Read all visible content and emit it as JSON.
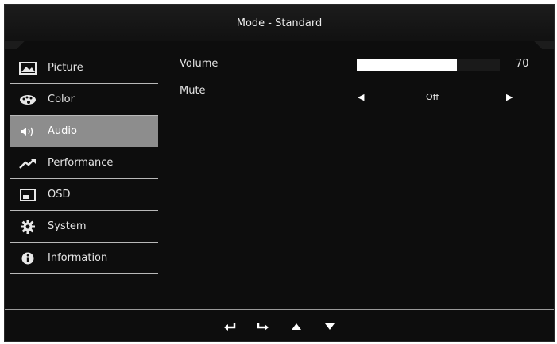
{
  "header": {
    "title": "Mode - Standard"
  },
  "sidebar": {
    "items": [
      {
        "label": "Picture",
        "icon": "picture-icon"
      },
      {
        "label": "Color",
        "icon": "palette-icon"
      },
      {
        "label": "Audio",
        "icon": "speaker-icon",
        "active": true
      },
      {
        "label": "Performance",
        "icon": "trend-up-icon"
      },
      {
        "label": "OSD",
        "icon": "osd-window-icon"
      },
      {
        "label": "System",
        "icon": "gear-icon"
      },
      {
        "label": "Information",
        "icon": "info-icon"
      }
    ]
  },
  "audio": {
    "volume_label": "Volume",
    "volume_value": "70",
    "volume_fraction": 0.7,
    "mute_label": "Mute",
    "mute_value": "Off"
  },
  "footer": {
    "buttons": [
      "back-arrow-icon",
      "enter-arrow-icon",
      "up-icon",
      "down-icon"
    ]
  },
  "colors": {
    "background": "#0d0d0d",
    "active_item": "#8d8d8d",
    "text": "#e4e4e4"
  }
}
